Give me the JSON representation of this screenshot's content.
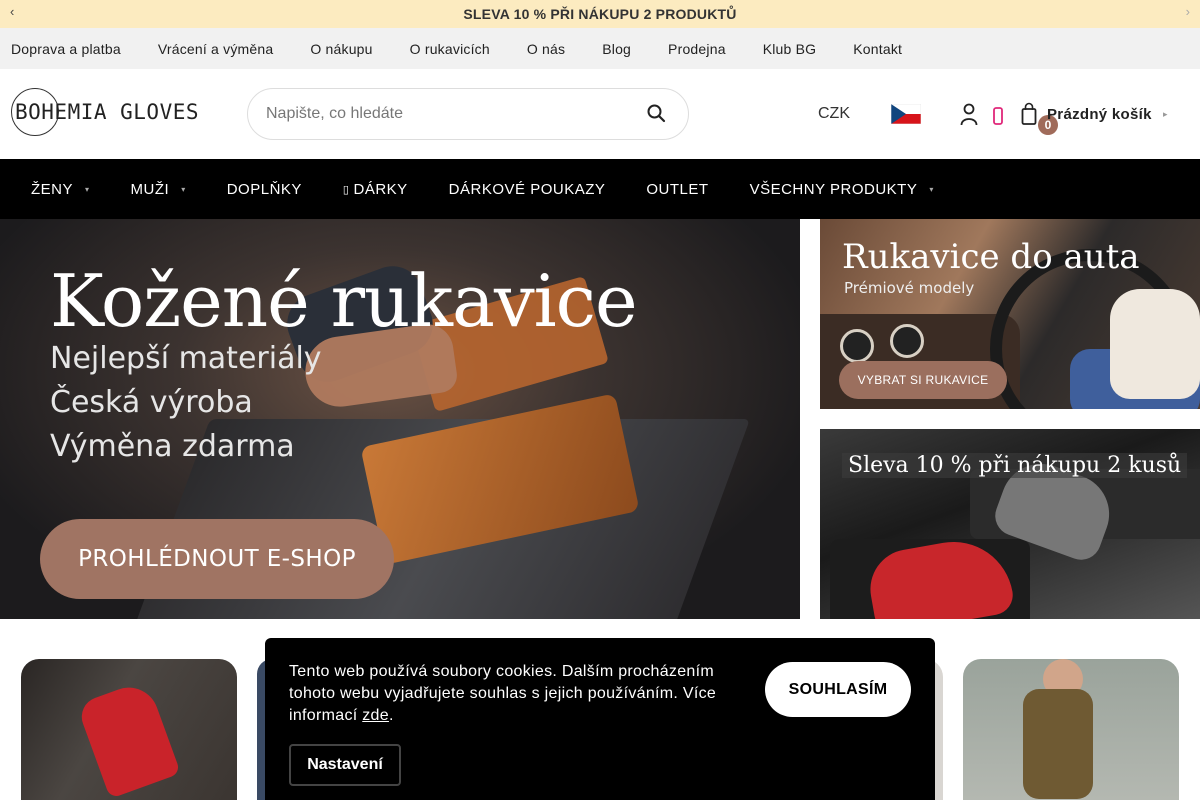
{
  "promo": {
    "text": "SLEVA 10 % PŘI NÁKUPU 2 PRODUKTŮ",
    "prev_glyph": "‹",
    "next_glyph": "›"
  },
  "top_links": [
    "Doprava a platba",
    "Vrácení a výměna",
    "O nákupu",
    "O rukavicích",
    "O nás",
    "Blog",
    "Prodejna",
    "Klub BG",
    "Kontakt"
  ],
  "header": {
    "logo_text": "BOHEMIA GLOVES",
    "search_placeholder": "Napište, co hledáte",
    "currency": "CZK",
    "cart_count": "0",
    "cart_label": "Prázdný košík"
  },
  "nav": [
    {
      "label": "ŽENY",
      "dropdown": true
    },
    {
      "label": "MUŽI",
      "dropdown": true
    },
    {
      "label": "DOPLŇKY",
      "dropdown": false
    },
    {
      "label": "DÁRKY",
      "dropdown": false
    },
    {
      "label": "DÁRKOVÉ POUKAZY",
      "dropdown": false
    },
    {
      "label": "OUTLET",
      "dropdown": false
    },
    {
      "label": "VŠECHNY PRODUKTY",
      "dropdown": true
    }
  ],
  "hero": {
    "title": "Kožené rukavice",
    "lines": [
      "Nejlepší materiály",
      "Česká výroba",
      "Výměna zdarma"
    ],
    "button": "PROHLÉDNOUT E-SHOP"
  },
  "banner1": {
    "title": "Rukavice do auta",
    "subtitle": "Prémiové modely",
    "button": "VYBRAT SI RUKAVICE"
  },
  "banner2": {
    "title": "Sleva 10 % při nákupu 2 kusů"
  },
  "cookie": {
    "text": "Tento web používá soubory cookies. Dalším procházením tohoto webu vyjadřujete souhlas s jejich používáním. Více informací",
    "link": "zde",
    "accept": "SOUHLASÍM",
    "settings": "Nastavení"
  },
  "colors": {
    "promo_bg": "#fcebc0",
    "nav_bg": "#000000",
    "accent": "#a07463",
    "cookie_bg": "#000000"
  }
}
